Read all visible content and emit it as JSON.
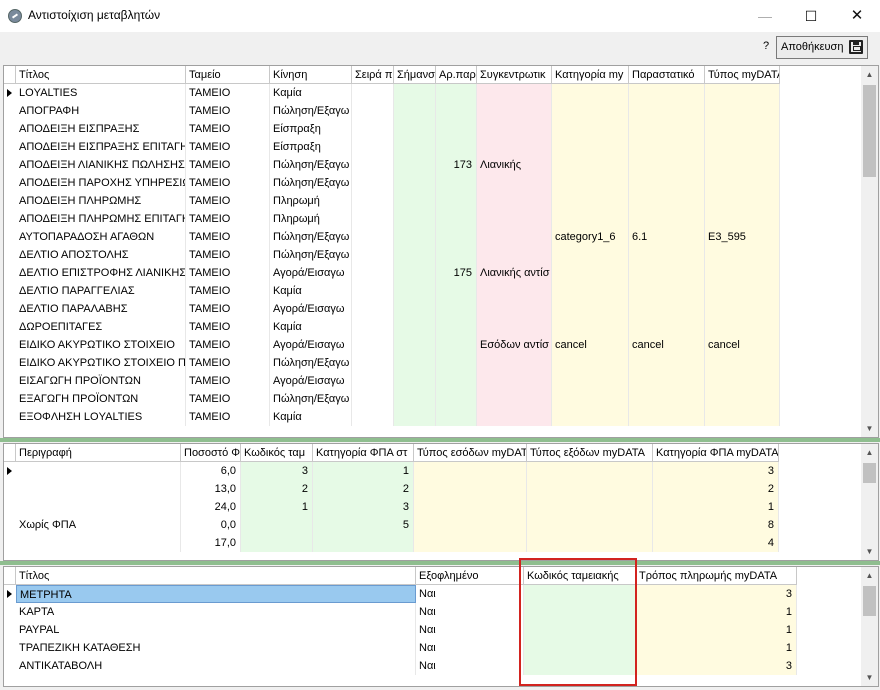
{
  "window": {
    "title": "Αντιστοίχιση μεταβλητών",
    "min": "—",
    "max": "☐",
    "close": "✕"
  },
  "toolbar": {
    "help": "?",
    "save_label": "Αποθήκευση"
  },
  "grid1": {
    "headers": [
      "Τίτλος",
      "Ταμείο",
      "Κίνηση",
      "Σειρά π",
      "Σήμανσ",
      "Αρ.παρ",
      "Συγκεντρωτικ",
      "Κατηγορία my",
      "Παραστατικό",
      "Τύπος myDATA"
    ],
    "rows": [
      [
        "LOYALTIES",
        "ΤΑΜΕΙΟ",
        "Καμία",
        "",
        "",
        "",
        "",
        "",
        "",
        ""
      ],
      [
        "ΑΠΟΓΡΑΦΗ",
        "ΤΑΜΕΙΟ",
        "Πώληση/Εξαγω",
        "",
        "",
        "",
        "",
        "",
        "",
        ""
      ],
      [
        "ΑΠΟΔΕΙΞΗ ΕΙΣΠΡΑΞΗΣ",
        "ΤΑΜΕΙΟ",
        "Είσπραξη",
        "",
        "",
        "",
        "",
        "",
        "",
        ""
      ],
      [
        "ΑΠΟΔΕΙΞΗ ΕΙΣΠΡΑΞΗΣ ΕΠΙΤΑΓΗ",
        "ΤΑΜΕΙΟ",
        "Είσπραξη",
        "",
        "",
        "",
        "",
        "",
        "",
        ""
      ],
      [
        "ΑΠΟΔΕΙΞΗ ΛΙΑΝΙΚΗΣ ΠΩΛΗΣΗΣ",
        "ΤΑΜΕΙΟ",
        "Πώληση/Εξαγω",
        "",
        "",
        "173",
        "Λιανικής",
        "",
        "",
        ""
      ],
      [
        "ΑΠΟΔΕΙΞΗ ΠΑΡΟΧΗΣ ΥΠΗΡΕΣΙΩΝ",
        "ΤΑΜΕΙΟ",
        "Πώληση/Εξαγω",
        "",
        "",
        "",
        "",
        "",
        "",
        ""
      ],
      [
        "ΑΠΟΔΕΙΞΗ ΠΛΗΡΩΜΗΣ",
        "ΤΑΜΕΙΟ",
        "Πληρωμή",
        "",
        "",
        "",
        "",
        "",
        "",
        ""
      ],
      [
        "ΑΠΟΔΕΙΞΗ ΠΛΗΡΩΜΗΣ ΕΠΙΤΑΓΗ",
        "ΤΑΜΕΙΟ",
        "Πληρωμή",
        "",
        "",
        "",
        "",
        "",
        "",
        ""
      ],
      [
        "ΑΥΤΟΠΑΡΑΔΟΣΗ ΑΓΑΘΩΝ",
        "ΤΑΜΕΙΟ",
        "Πώληση/Εξαγω",
        "",
        "",
        "",
        "",
        "category1_6",
        "6.1",
        "E3_595"
      ],
      [
        "ΔΕΛΤΙΟ ΑΠΟΣΤΟΛΗΣ",
        "ΤΑΜΕΙΟ",
        "Πώληση/Εξαγω",
        "",
        "",
        "",
        "",
        "",
        "",
        ""
      ],
      [
        "ΔΕΛΤΙΟ ΕΠΙΣΤΡΟΦΗΣ ΛΙΑΝΙΚΗΣ",
        "ΤΑΜΕΙΟ",
        "Αγορά/Εισαγω",
        "",
        "",
        "175",
        "Λιανικής αντίσ",
        "",
        "",
        ""
      ],
      [
        "ΔΕΛΤΙΟ ΠΑΡΑΓΓΕΛΙΑΣ",
        "ΤΑΜΕΙΟ",
        "Καμία",
        "",
        "",
        "",
        "",
        "",
        "",
        ""
      ],
      [
        "ΔΕΛΤΙΟ ΠΑΡΑΛΑΒΗΣ",
        "ΤΑΜΕΙΟ",
        "Αγορά/Εισαγω",
        "",
        "",
        "",
        "",
        "",
        "",
        ""
      ],
      [
        "ΔΩΡΟΕΠΙΤΑΓΕΣ",
        "ΤΑΜΕΙΟ",
        "Καμία",
        "",
        "",
        "",
        "",
        "",
        "",
        ""
      ],
      [
        "ΕΙΔΙΚΟ ΑΚΥΡΩΤΙΚΟ ΣΤΟΙΧΕΙΟ",
        "ΤΑΜΕΙΟ",
        "Αγορά/Εισαγω",
        "",
        "",
        "",
        "Εσόδων αντίσ",
        "cancel",
        "cancel",
        "cancel"
      ],
      [
        "ΕΙΔΙΚΟ ΑΚΥΡΩΤΙΚΟ ΣΤΟΙΧΕΙΟ ΠΙΣΤ",
        "ΤΑΜΕΙΟ",
        "Πώληση/Εξαγω",
        "",
        "",
        "",
        "",
        "",
        "",
        ""
      ],
      [
        "ΕΙΣΑΓΩΓΗ ΠΡΟΪΟΝΤΩΝ",
        "ΤΑΜΕΙΟ",
        "Αγορά/Εισαγω",
        "",
        "",
        "",
        "",
        "",
        "",
        ""
      ],
      [
        "ΕΞΑΓΩΓΗ ΠΡΟΪΟΝΤΩΝ",
        "ΤΑΜΕΙΟ",
        "Πώληση/Εξαγω",
        "",
        "",
        "",
        "",
        "",
        "",
        ""
      ],
      [
        "ΕΞΟΦΛΗΣΗ LOYALTIES",
        "ΤΑΜΕΙΟ",
        "Καμία",
        "",
        "",
        "",
        "",
        "",
        "",
        ""
      ]
    ]
  },
  "grid2": {
    "headers": [
      "Περιγραφή",
      "Ποσοστό Φ",
      "Κωδικός ταμ",
      "Κατηγορία ΦΠΑ στ",
      "Τύπος εσόδων myDAT",
      "Τύπος εξόδων myDATA",
      "Κατηγορία ΦΠΑ myDATA"
    ],
    "rows": [
      [
        "",
        "6,0",
        "3",
        "1",
        "",
        "",
        "3"
      ],
      [
        "",
        "13,0",
        "2",
        "2",
        "",
        "",
        "2"
      ],
      [
        "",
        "24,0",
        "1",
        "3",
        "",
        "",
        "1"
      ],
      [
        "Χωρίς ΦΠΑ",
        "0,0",
        "",
        "5",
        "",
        "",
        "8"
      ],
      [
        "",
        "17,0",
        "",
        "",
        "",
        "",
        "4"
      ]
    ]
  },
  "grid3": {
    "headers": [
      "Τίτλος",
      "Εξοφλημένο",
      "Κωδικός ταμειακής",
      "Τρόπος πληρωμής myDATA"
    ],
    "rows": [
      [
        "ΜΕΤΡΗΤΑ",
        "Ναι",
        "",
        "3"
      ],
      [
        "ΚΑΡΤΑ",
        "Ναι",
        "",
        "1"
      ],
      [
        "PAYPAL",
        "Ναι",
        "",
        "1"
      ],
      [
        "ΤΡΑΠΕΖΙΚΗ ΚΑΤΑΘΕΣΗ",
        "Ναι",
        "",
        "1"
      ],
      [
        "ΑΝΤΙΚΑΤΑΒΟΛΗ",
        "Ναι",
        "",
        "3"
      ]
    ]
  },
  "colors": {
    "green": "#e6fae6",
    "pink": "#fde8ec",
    "yellow": "#fffbe0",
    "cyan": "#e8fbf8",
    "highlight": "#d2231f"
  }
}
